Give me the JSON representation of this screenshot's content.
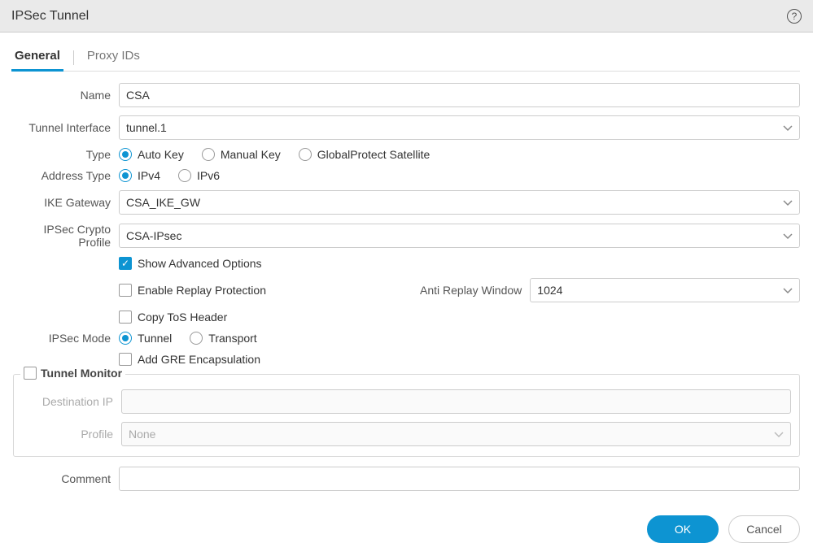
{
  "title": "IPSec Tunnel",
  "tabs": {
    "general": "General",
    "proxy_ids": "Proxy IDs"
  },
  "labels": {
    "name": "Name",
    "tunnel_interface": "Tunnel Interface",
    "type": "Type",
    "address_type": "Address Type",
    "ike_gateway": "IKE Gateway",
    "ipsec_crypto_profile": "IPSec Crypto Profile",
    "ipsec_mode": "IPSec Mode",
    "anti_replay_window": "Anti Replay Window",
    "destination_ip": "Destination IP",
    "profile": "Profile",
    "comment": "Comment"
  },
  "type_options": {
    "auto_key": "Auto Key",
    "manual_key": "Manual Key",
    "gp_satellite": "GlobalProtect Satellite"
  },
  "address_options": {
    "ipv4": "IPv4",
    "ipv6": "IPv6"
  },
  "checkboxes": {
    "show_advanced": "Show Advanced Options",
    "enable_replay": "Enable Replay Protection",
    "copy_tos": "Copy ToS Header",
    "add_gre": "Add GRE Encapsulation"
  },
  "ipsec_mode_options": {
    "tunnel": "Tunnel",
    "transport": "Transport"
  },
  "tunnel_monitor": {
    "legend": "Tunnel Monitor",
    "profile_value": "None"
  },
  "values": {
    "name": "CSA",
    "tunnel_interface": "tunnel.1",
    "ike_gateway": "CSA_IKE_GW",
    "ipsec_crypto_profile": "CSA-IPsec",
    "anti_replay_window": "1024",
    "destination_ip": "",
    "comment": ""
  },
  "buttons": {
    "ok": "OK",
    "cancel": "Cancel"
  }
}
